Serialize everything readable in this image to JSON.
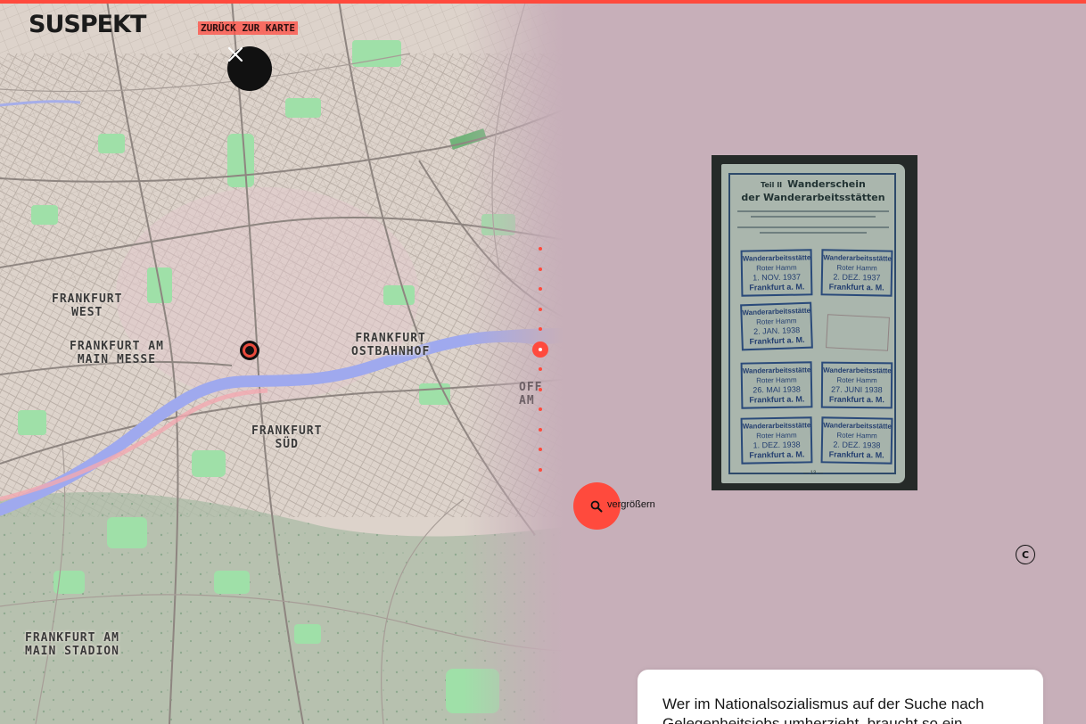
{
  "app": {
    "brand": "SUSPEKT",
    "back_link": "ZURÜCK ZUR KARTE",
    "accent_color": "#ff4a3d",
    "background_color": "#c7afb9"
  },
  "map": {
    "districts": [
      {
        "id": "west",
        "label": "FRANKFURT\nWEST"
      },
      {
        "id": "messe",
        "label": "FRANKFURT AM\nMAIN MESSE"
      },
      {
        "id": "ostbahnhof",
        "label": "FRANKFURT\nOSTBAHNHOF"
      },
      {
        "id": "sued",
        "label": "FRANKFURT\nSÜD"
      },
      {
        "id": "stadion",
        "label": "FRANKFURT AM\nMAIN STADION"
      },
      {
        "id": "offenbach",
        "label": "OFF\nAM"
      }
    ],
    "close_icon": "close-icon",
    "pin_icon": "location-pin-icon"
  },
  "pager": {
    "count": 12,
    "active_index": 5
  },
  "document": {
    "teil": "Teil II",
    "title_line1": "Wanderschein",
    "title_line2": "der Wanderarbeitsstätten",
    "stamps": [
      {
        "org": "Wanderarbeitsstätte",
        "name": "Roter Hamm",
        "date": "1. NOV. 1937",
        "city": "Frankfurt a. M."
      },
      {
        "org": "Wanderarbeitsstätte",
        "name": "Roter Hamm",
        "date": "2. DEZ. 1937",
        "city": "Frankfurt a. M."
      },
      {
        "org": "Wanderarbeitsstätte",
        "name": "Roter Hamm",
        "date": "2. JAN. 1938",
        "city": "Frankfurt a. M."
      },
      {
        "org": "Wanderarbeitsstätte",
        "name": "Roter Hamm",
        "date": "26. MAI 1938",
        "city": "Frankfurt a. M."
      },
      {
        "org": "Wanderarbeitsstätte",
        "name": "Roter Hamm",
        "date": "27. JUNI 1938",
        "city": "Frankfurt a. M."
      },
      {
        "org": "Wanderarbeitsstätte",
        "name": "Roter Hamm",
        "date": "1. DEZ. 1938",
        "city": "Frankfurt a. M."
      },
      {
        "org": "Wanderarbeitsstätte",
        "name": "Roter Hamm",
        "date": "2. DEZ. 1938",
        "city": "Frankfurt a. M."
      }
    ],
    "page_number": "— 13 —"
  },
  "zoom": {
    "label": "vergrößern",
    "icon": "magnifier-icon"
  },
  "copyright": {
    "label": "C"
  },
  "text_card": {
    "text": "Wer im Nationalsozialismus auf der Suche nach Gelegenheitsjobs umherzieht, braucht so ein"
  }
}
